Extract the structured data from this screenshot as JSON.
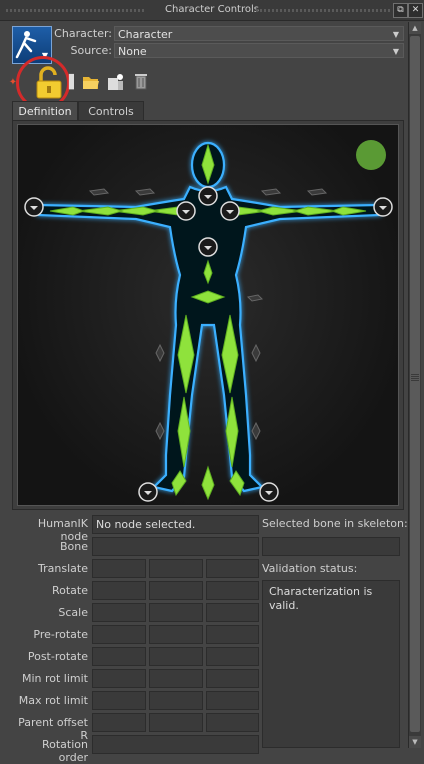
{
  "window": {
    "title": "Character Controls",
    "restore_icon": "⧉",
    "close_icon": "✕"
  },
  "header": {
    "character_label": "Character:",
    "character_value": "Character",
    "source_label": "Source:",
    "source_value": "None"
  },
  "toolbar": {
    "icons": [
      "pin-icon",
      "lock-icon",
      "open-folder-icon",
      "characterize-icon",
      "trash-icon"
    ]
  },
  "tabs": [
    {
      "label": "Definition",
      "active": true
    },
    {
      "label": "Controls",
      "active": false
    }
  ],
  "viewport": {
    "status_color": "#5a9a34",
    "bone_color": "#8fe23c",
    "glow_color": "#3bb0ff"
  },
  "details": {
    "humanik_node_label": "HumanIK node",
    "humanik_node_value": "No node selected.",
    "bone_label": "Bone",
    "translate_label": "Translate",
    "rotate_label": "Rotate",
    "scale_label": "Scale",
    "pre_rotate_label": "Pre-rotate",
    "post_rotate_label": "Post-rotate",
    "min_rot_label": "Min rot limit",
    "max_rot_label": "Max rot limit",
    "parent_offset_label": "Parent offset R",
    "rotation_order_label": "Rotation order",
    "selected_bone_label": "Selected bone in skeleton:",
    "validation_label": "Validation status:",
    "validation_text": "Characterization is valid."
  }
}
